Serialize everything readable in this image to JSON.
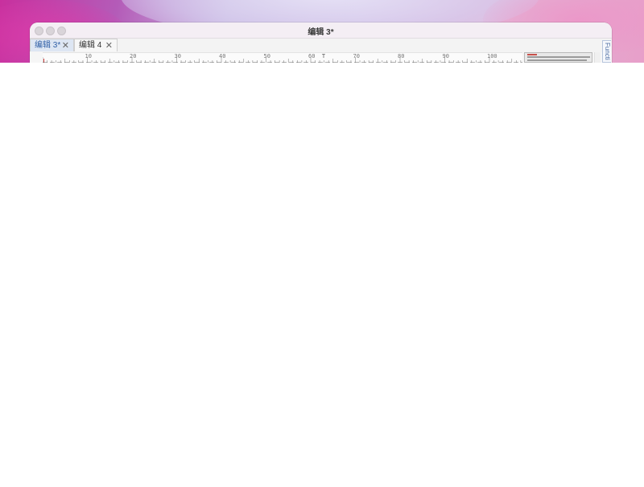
{
  "window": {
    "title": "编辑 3*"
  },
  "tabs": [
    {
      "label": "编辑 3*",
      "active": true,
      "close_glyph": "✕"
    },
    {
      "label": "编辑 4",
      "active": false,
      "close_glyph": "✕"
    }
  ],
  "ruler": {
    "labels": [
      "10",
      "20",
      "30",
      "40",
      "50",
      "60",
      "70",
      "80",
      "90",
      "100"
    ],
    "marker": "T"
  },
  "side_panel": {
    "label": "Functi"
  },
  "icons": {
    "close": "close-icon",
    "minimize": "minimize-icon",
    "zoom": "zoom-icon",
    "tab_close": "close-icon"
  },
  "colors": {
    "active_tab_text": "#2f5fa6",
    "active_tab_bg": "#dde6f3",
    "side_panel_text": "#4a6aa0"
  }
}
